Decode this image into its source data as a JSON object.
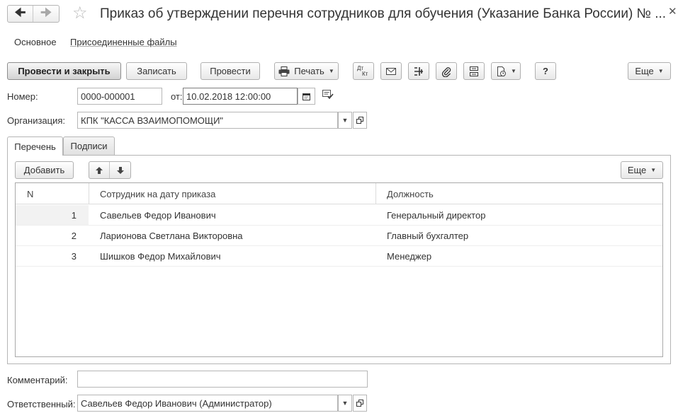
{
  "window": {
    "title": "Приказ об утверждении перечня сотрудников для обучения (Указание Банка России) № ..."
  },
  "nav": {
    "main_label": "Основное",
    "attachments_label": "Присоединенные файлы"
  },
  "toolbar": {
    "post_close": "Провести и закрыть",
    "save": "Записать",
    "post": "Провести",
    "print": "Печать",
    "dtkt_top": "Дт",
    "dtkt_bottom": "Кт",
    "help": "?",
    "more": "Еще"
  },
  "form": {
    "number_label": "Номер:",
    "number_value": "0000-000001",
    "date_label": "от:",
    "date_value": "10.02.2018 12:00:00",
    "org_label": "Организация:",
    "org_value": "КПК \"КАССА ВЗАИМОПОМОЩИ\"",
    "comment_label": "Комментарий:",
    "comment_value": "",
    "responsible_label": "Ответственный:",
    "responsible_value": "Савельев Федор Иванович (Администратор)"
  },
  "tabs": [
    {
      "label": "Перечень",
      "active": true
    },
    {
      "label": "Подписи",
      "active": false
    }
  ],
  "table_toolbar": {
    "add": "Добавить",
    "more": "Еще"
  },
  "table": {
    "columns": [
      "N",
      "Сотрудник на дату приказа",
      "Должность"
    ],
    "rows": [
      {
        "n": "1",
        "employee": "Савельев Федор Иванович",
        "position": "Генеральный директор"
      },
      {
        "n": "2",
        "employee": "Ларионова Светлана Викторовна",
        "position": "Главный бухгалтер"
      },
      {
        "n": "3",
        "employee": "Шишков Федор Михайлович",
        "position": "Менеджер"
      }
    ]
  }
}
